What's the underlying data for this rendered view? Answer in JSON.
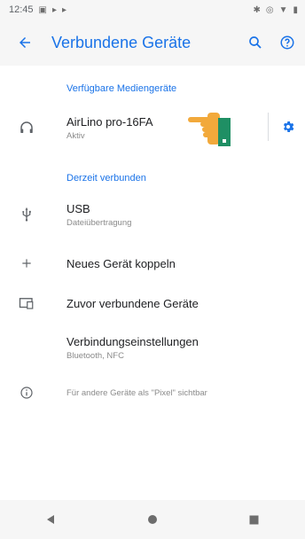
{
  "status_bar": {
    "time": "12:45"
  },
  "app_bar": {
    "title": "Verbundene Geräte"
  },
  "sections": {
    "available_media_header": "Verfügbare Mediengeräte",
    "connected_header": "Derzeit verbunden"
  },
  "devices": {
    "airlino": {
      "name": "AirLino pro-16FA",
      "status": "Aktiv"
    },
    "usb": {
      "name": "USB",
      "status": "Dateiübertragung"
    }
  },
  "actions": {
    "pair_new": "Neues Gerät koppeln",
    "previously_connected": "Zuvor verbundene Geräte",
    "connection_prefs": {
      "title": "Verbindungseinstellungen",
      "subtitle": "Bluetooth, NFC"
    }
  },
  "footer_info": "Für andere Geräte als \"Pixel\" sichtbar",
  "colors": {
    "accent": "#1a73e8",
    "hand_skin": "#f2a93b",
    "cuff": "#1f8f64"
  }
}
